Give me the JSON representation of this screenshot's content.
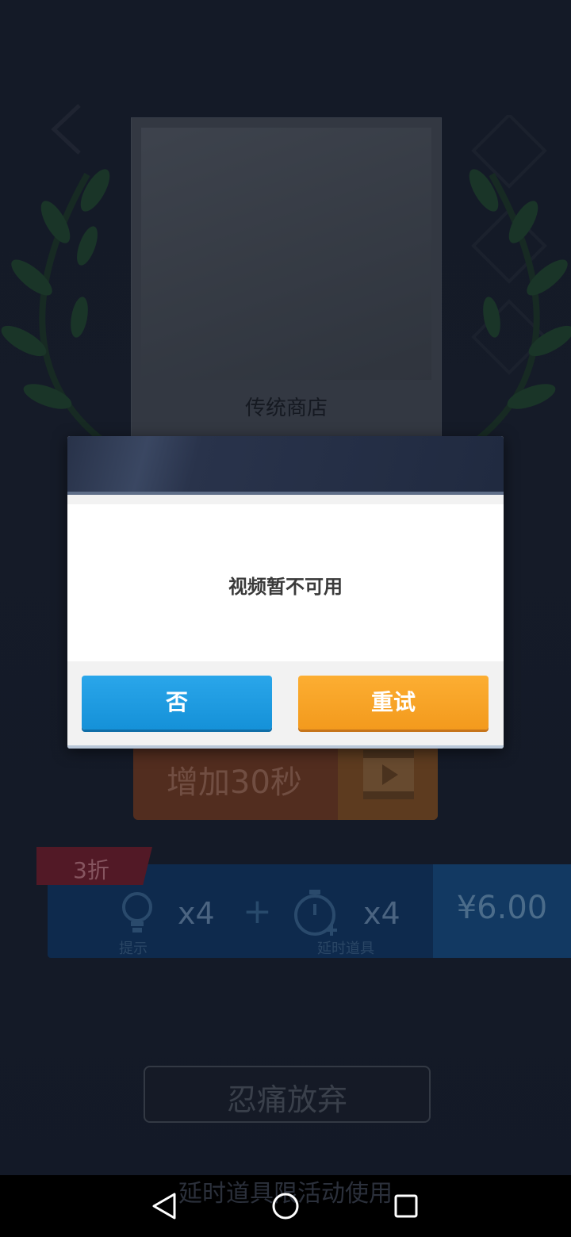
{
  "background": {
    "card": {
      "title": "传统商店"
    },
    "add_time_button": {
      "label": "增加30秒"
    },
    "promo": {
      "discount_badge": "3折",
      "hint_qty": "x4",
      "hint_label": "提示",
      "plus": "+",
      "timer_qty": "x4",
      "timer_label": "延时道具",
      "price": "¥6.00"
    },
    "give_up_button": {
      "label": "忍痛放弃"
    },
    "bottom_hint": "延时道具限活动使用"
  },
  "dialog": {
    "message": "视频暂不可用",
    "no_button": "否",
    "retry_button": "重试"
  },
  "colors": {
    "no_button": "#1a9be0",
    "retry_button": "#f7a526",
    "header": "#283249"
  }
}
